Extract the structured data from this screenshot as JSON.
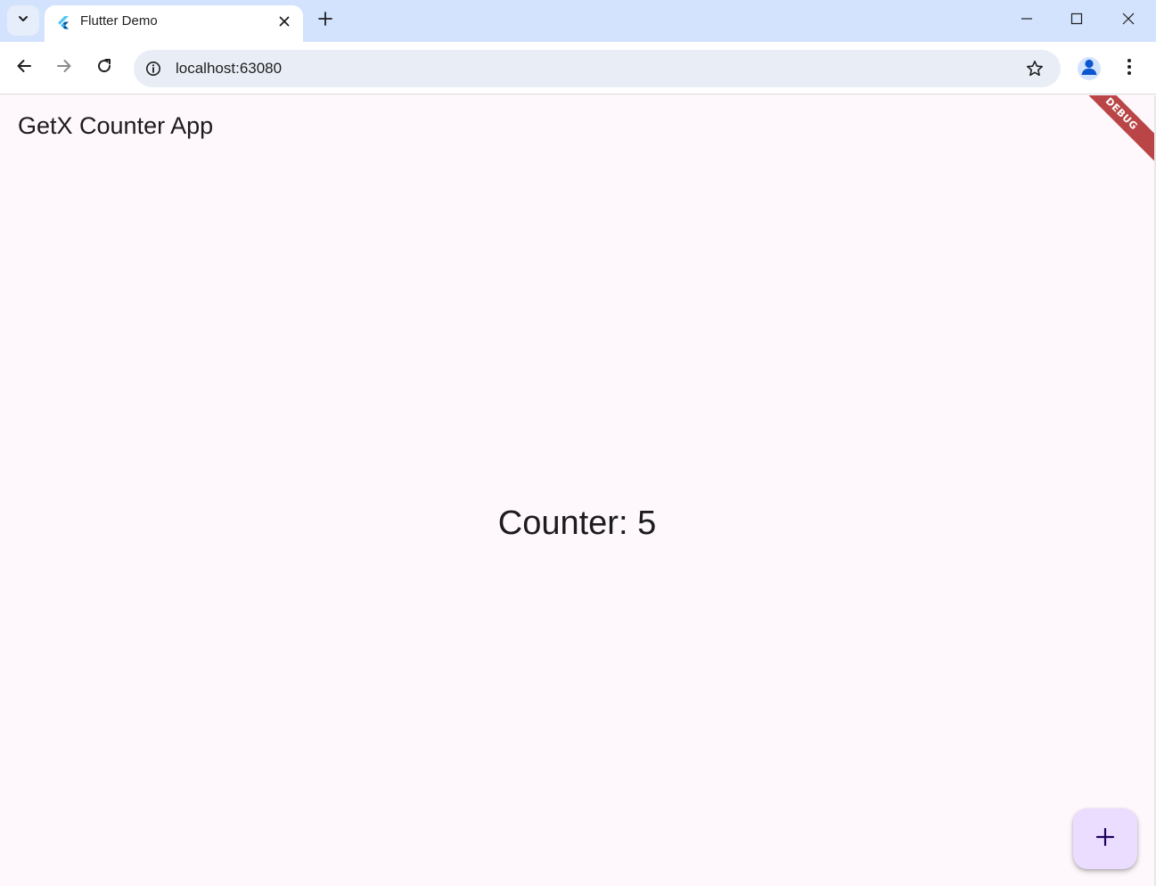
{
  "browser": {
    "tab": {
      "title": "Flutter Demo"
    },
    "address_bar": {
      "url": "localhost:63080"
    }
  },
  "app": {
    "title": "GetX Counter App",
    "counter_text": "Counter: 5",
    "debug_banner": "DEBUG",
    "fab_icon": "add-icon"
  },
  "colors": {
    "tabstrip": "#d3e3fd",
    "app_background": "#fef7fb",
    "fab_background": "#eaddff",
    "fab_icon": "#21005d",
    "text": "#1d1b20"
  }
}
